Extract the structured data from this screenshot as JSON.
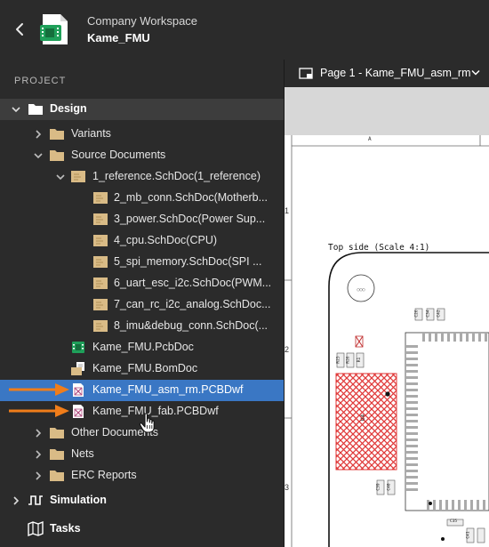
{
  "header": {
    "workspace_label": "Company Workspace",
    "project_name": "Kame_FMU"
  },
  "sidebar": {
    "section_label": "PROJECT",
    "tree": {
      "design": "Design",
      "variants": "Variants",
      "source_documents": "Source Documents",
      "reference": "1_reference.SchDoc(1_reference)",
      "children": [
        "2_mb_conn.SchDoc(Motherb...",
        "3_power.SchDoc(Power Sup...",
        "4_cpu.SchDoc(CPU)",
        "5_spi_memory.SchDoc(SPI ...",
        "6_uart_esc_i2c.SchDoc(PWM...",
        "7_can_rc_i2c_analog.SchDoc...",
        "8_imu&debug_conn.SchDoc(..."
      ],
      "pcbdoc": "Kame_FMU.PcbDoc",
      "bomdoc": "Kame_FMU.BomDoc",
      "asm": "Kame_FMU_asm_rm.PCBDwf",
      "fab": "Kame_FMU_fab.PCBDwf",
      "other": "Other Documents",
      "nets": "Nets",
      "erc": "ERC Reports",
      "simulation": "Simulation",
      "tasks": "Tasks"
    }
  },
  "viewer": {
    "page_selector": "Page 1 - Kame_FMU_asm_rm",
    "col_a": "A",
    "rows": [
      "1",
      "2",
      "3"
    ],
    "view_caption": "Top side (Scale 4:1)",
    "ref_u4": "U4",
    "refs": [
      "C26",
      "C34",
      "C42",
      "R25",
      "R26",
      "R1",
      "C39",
      "C40",
      "C35",
      "C41"
    ]
  },
  "colors": {
    "selection": "#3a77c4",
    "folder": "#d9bb86",
    "arrow": "#f07d1a",
    "hatch": "#e03a3a"
  }
}
